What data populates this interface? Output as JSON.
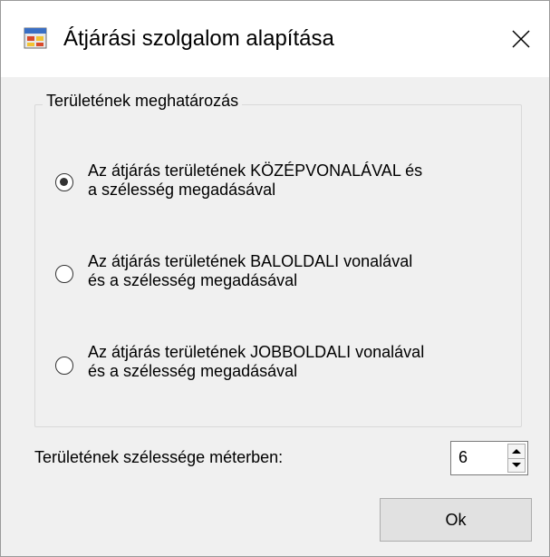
{
  "window": {
    "title": "Átjárási szolgalom alapítása",
    "app_icon": "window-app-icon",
    "close_icon": "close-icon"
  },
  "group": {
    "label": "Területének meghatározás",
    "options": [
      {
        "label": "Az átjárás területének KÖZÉPVONALÁVAL és\na szélesség megadásával",
        "selected": true
      },
      {
        "label": "Az átjárás területének BALOLDALI vonalával\nés a szélesség megadásával",
        "selected": false
      },
      {
        "label": "Az átjárás területének JOBBOLDALI vonalával\nés a szélesség megadásával",
        "selected": false
      }
    ]
  },
  "width": {
    "label": "Területének szélessége méterben:",
    "value": "6"
  },
  "buttons": {
    "ok_label": "Ok"
  }
}
